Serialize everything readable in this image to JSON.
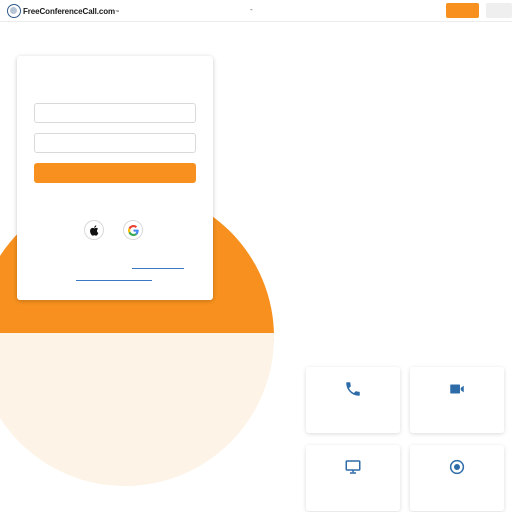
{
  "header": {
    "logo_text": "FreeConferenceCall.com",
    "logo_tm": "™",
    "center_glyph": "-"
  },
  "login": {
    "email_value": "",
    "password_value": "",
    "social": [
      "apple-icon",
      "google-icon"
    ]
  },
  "features": [
    "phone-icon",
    "video-icon",
    "monitor-icon",
    "record-icon"
  ],
  "colors": {
    "accent": "#f7901e",
    "icon_blue": "#2d6ca8",
    "cream": "#fdf3e7",
    "link_blue": "#3a78c3"
  }
}
